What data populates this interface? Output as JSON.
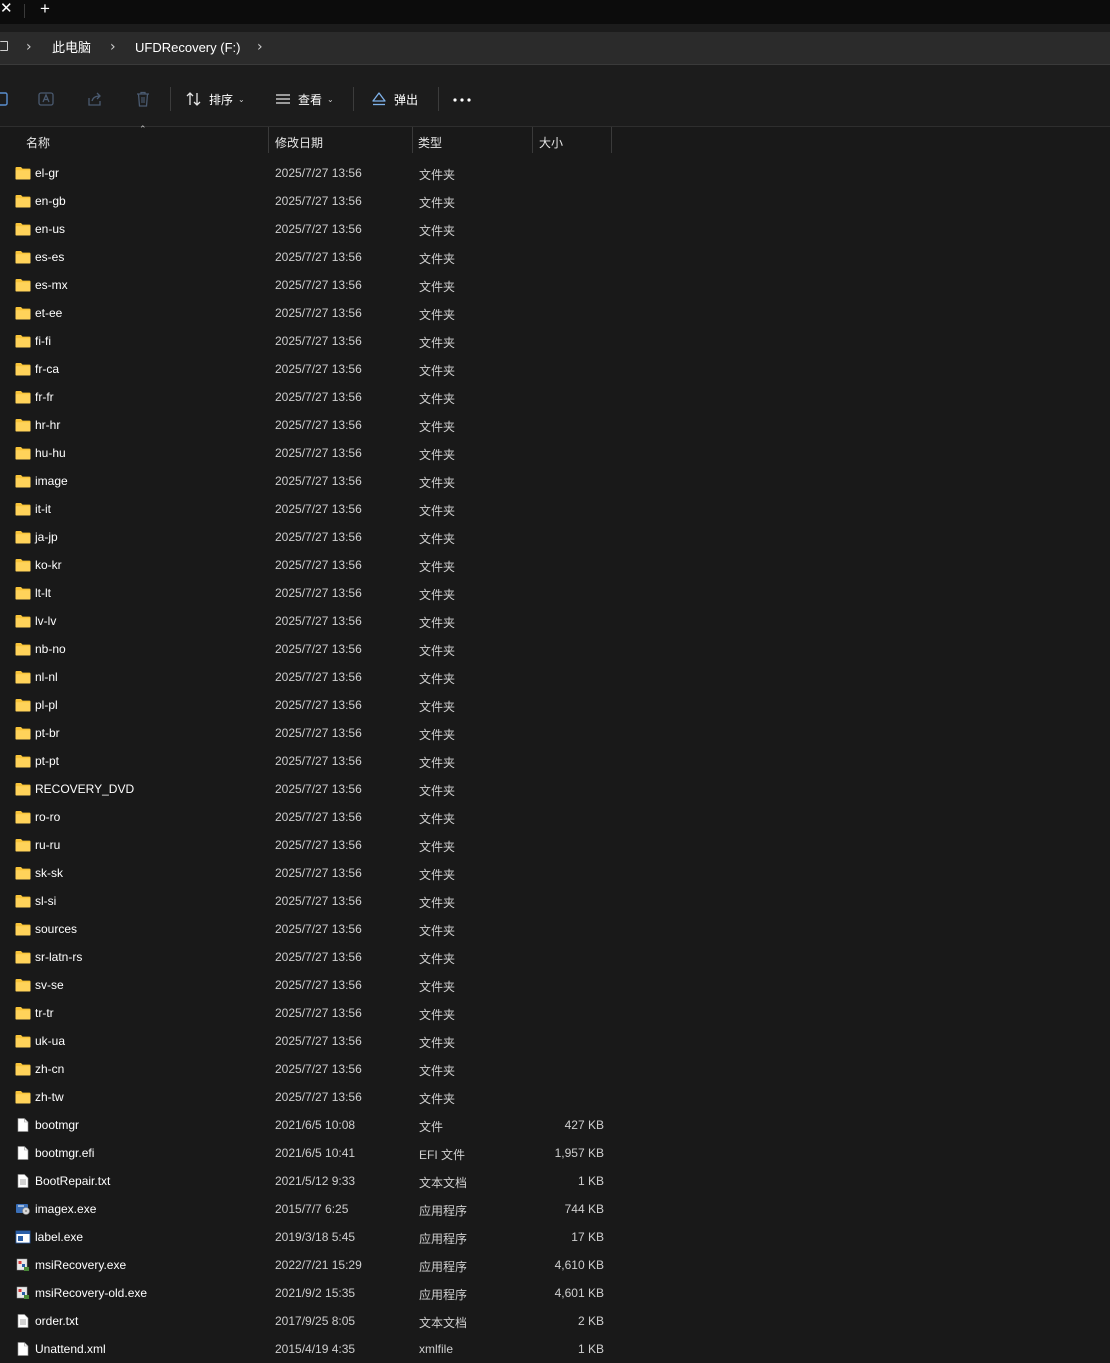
{
  "tabbar": {
    "close_glyph": "✕",
    "new_tab_glyph": "+"
  },
  "breadcrumb": {
    "items": [
      "此电脑",
      "UFDRecovery (F:)"
    ],
    "separator": "›"
  },
  "toolbar": {
    "sort_label": "排序",
    "view_label": "查看",
    "eject_label": "弹出",
    "more_label": "..."
  },
  "columns": {
    "name": "名称",
    "date": "修改日期",
    "type": "类型",
    "size": "大小"
  },
  "files": [
    {
      "name": "el-gr",
      "date": "2025/7/27 13:56",
      "type": "文件夹",
      "size": "",
      "icon": "folder-icon"
    },
    {
      "name": "en-gb",
      "date": "2025/7/27 13:56",
      "type": "文件夹",
      "size": "",
      "icon": "folder-icon"
    },
    {
      "name": "en-us",
      "date": "2025/7/27 13:56",
      "type": "文件夹",
      "size": "",
      "icon": "folder-icon"
    },
    {
      "name": "es-es",
      "date": "2025/7/27 13:56",
      "type": "文件夹",
      "size": "",
      "icon": "folder-icon"
    },
    {
      "name": "es-mx",
      "date": "2025/7/27 13:56",
      "type": "文件夹",
      "size": "",
      "icon": "folder-icon"
    },
    {
      "name": "et-ee",
      "date": "2025/7/27 13:56",
      "type": "文件夹",
      "size": "",
      "icon": "folder-icon"
    },
    {
      "name": "fi-fi",
      "date": "2025/7/27 13:56",
      "type": "文件夹",
      "size": "",
      "icon": "folder-icon"
    },
    {
      "name": "fr-ca",
      "date": "2025/7/27 13:56",
      "type": "文件夹",
      "size": "",
      "icon": "folder-icon"
    },
    {
      "name": "fr-fr",
      "date": "2025/7/27 13:56",
      "type": "文件夹",
      "size": "",
      "icon": "folder-icon"
    },
    {
      "name": "hr-hr",
      "date": "2025/7/27 13:56",
      "type": "文件夹",
      "size": "",
      "icon": "folder-icon"
    },
    {
      "name": "hu-hu",
      "date": "2025/7/27 13:56",
      "type": "文件夹",
      "size": "",
      "icon": "folder-icon"
    },
    {
      "name": "image",
      "date": "2025/7/27 13:56",
      "type": "文件夹",
      "size": "",
      "icon": "folder-icon"
    },
    {
      "name": "it-it",
      "date": "2025/7/27 13:56",
      "type": "文件夹",
      "size": "",
      "icon": "folder-icon"
    },
    {
      "name": "ja-jp",
      "date": "2025/7/27 13:56",
      "type": "文件夹",
      "size": "",
      "icon": "folder-icon"
    },
    {
      "name": "ko-kr",
      "date": "2025/7/27 13:56",
      "type": "文件夹",
      "size": "",
      "icon": "folder-icon"
    },
    {
      "name": "lt-lt",
      "date": "2025/7/27 13:56",
      "type": "文件夹",
      "size": "",
      "icon": "folder-icon"
    },
    {
      "name": "lv-lv",
      "date": "2025/7/27 13:56",
      "type": "文件夹",
      "size": "",
      "icon": "folder-icon"
    },
    {
      "name": "nb-no",
      "date": "2025/7/27 13:56",
      "type": "文件夹",
      "size": "",
      "icon": "folder-icon"
    },
    {
      "name": "nl-nl",
      "date": "2025/7/27 13:56",
      "type": "文件夹",
      "size": "",
      "icon": "folder-icon"
    },
    {
      "name": "pl-pl",
      "date": "2025/7/27 13:56",
      "type": "文件夹",
      "size": "",
      "icon": "folder-icon"
    },
    {
      "name": "pt-br",
      "date": "2025/7/27 13:56",
      "type": "文件夹",
      "size": "",
      "icon": "folder-icon"
    },
    {
      "name": "pt-pt",
      "date": "2025/7/27 13:56",
      "type": "文件夹",
      "size": "",
      "icon": "folder-icon"
    },
    {
      "name": "RECOVERY_DVD",
      "date": "2025/7/27 13:56",
      "type": "文件夹",
      "size": "",
      "icon": "folder-icon"
    },
    {
      "name": "ro-ro",
      "date": "2025/7/27 13:56",
      "type": "文件夹",
      "size": "",
      "icon": "folder-icon"
    },
    {
      "name": "ru-ru",
      "date": "2025/7/27 13:56",
      "type": "文件夹",
      "size": "",
      "icon": "folder-icon"
    },
    {
      "name": "sk-sk",
      "date": "2025/7/27 13:56",
      "type": "文件夹",
      "size": "",
      "icon": "folder-icon"
    },
    {
      "name": "sl-si",
      "date": "2025/7/27 13:56",
      "type": "文件夹",
      "size": "",
      "icon": "folder-icon"
    },
    {
      "name": "sources",
      "date": "2025/7/27 13:56",
      "type": "文件夹",
      "size": "",
      "icon": "folder-icon"
    },
    {
      "name": "sr-latn-rs",
      "date": "2025/7/27 13:56",
      "type": "文件夹",
      "size": "",
      "icon": "folder-icon"
    },
    {
      "name": "sv-se",
      "date": "2025/7/27 13:56",
      "type": "文件夹",
      "size": "",
      "icon": "folder-icon"
    },
    {
      "name": "tr-tr",
      "date": "2025/7/27 13:56",
      "type": "文件夹",
      "size": "",
      "icon": "folder-icon"
    },
    {
      "name": "uk-ua",
      "date": "2025/7/27 13:56",
      "type": "文件夹",
      "size": "",
      "icon": "folder-icon"
    },
    {
      "name": "zh-cn",
      "date": "2025/7/27 13:56",
      "type": "文件夹",
      "size": "",
      "icon": "folder-icon"
    },
    {
      "name": "zh-tw",
      "date": "2025/7/27 13:56",
      "type": "文件夹",
      "size": "",
      "icon": "folder-icon"
    },
    {
      "name": "bootmgr",
      "date": "2021/6/5 10:08",
      "type": "文件",
      "size": "427 KB",
      "icon": "file-icon"
    },
    {
      "name": "bootmgr.efi",
      "date": "2021/6/5 10:41",
      "type": "EFI 文件",
      "size": "1,957 KB",
      "icon": "file-icon"
    },
    {
      "name": "BootRepair.txt",
      "date": "2021/5/12 9:33",
      "type": "文本文档",
      "size": "1 KB",
      "icon": "text-file-icon"
    },
    {
      "name": "imagex.exe",
      "date": "2015/7/7 6:25",
      "type": "应用程序",
      "size": "744 KB",
      "icon": "imagex-app-icon"
    },
    {
      "name": "label.exe",
      "date": "2019/3/18 5:45",
      "type": "应用程序",
      "size": "17 KB",
      "icon": "window-app-icon"
    },
    {
      "name": "msiRecovery.exe",
      "date": "2022/7/21 15:29",
      "type": "应用程序",
      "size": "4,610 KB",
      "icon": "msi-app-icon"
    },
    {
      "name": "msiRecovery-old.exe",
      "date": "2021/9/2 15:35",
      "type": "应用程序",
      "size": "4,601 KB",
      "icon": "msi-app-icon"
    },
    {
      "name": "order.txt",
      "date": "2017/9/25 8:05",
      "type": "文本文档",
      "size": "2 KB",
      "icon": "text-file-icon"
    },
    {
      "name": "Unattend.xml",
      "date": "2015/4/19 4:35",
      "type": "xmlfile",
      "size": "1 KB",
      "icon": "file-icon"
    }
  ],
  "colors": {
    "folder": "#f8c43a",
    "background": "#191919",
    "text": "#ffffff",
    "secondary_text": "#cfcfcf"
  }
}
